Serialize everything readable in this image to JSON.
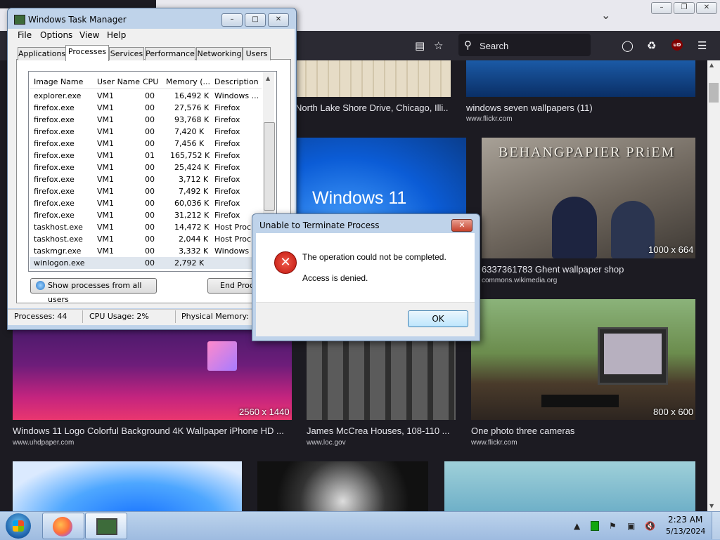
{
  "firefox": {
    "search": {
      "placeholder": "Search"
    },
    "ublock_badge": "uD",
    "cards": [
      {
        "title": "North Lake Shore Drive, Chicago, Illi...",
        "source": "",
        "dims": ""
      },
      {
        "title": "windows seven wallpapers (11)",
        "source": "www.flickr.com",
        "dims": ""
      },
      {
        "title": "",
        "source": "",
        "dims": ""
      },
      {
        "title": "6337361783 Ghent wallpaper shop",
        "source": "commons.wikimedia.org",
        "dims": "1000 x 664"
      },
      {
        "title": "Windows 11 Logo Colorful Background 4K Wallpaper iPhone HD ...",
        "source": "www.uhdpaper.com",
        "dims": "2560 x 1440"
      },
      {
        "title": "James McCrea Houses, 108-110 ...",
        "source": "www.loc.gov",
        "dims": ""
      },
      {
        "title": "One photo three cameras",
        "source": "www.flickr.com",
        "dims": "800 x 600"
      }
    ],
    "windows11_text": "Windows 11",
    "priem_text": "BEHANGPAPIER PRiEM"
  },
  "taskmanager": {
    "title": "Windows Task Manager",
    "menu": [
      "File",
      "Options",
      "View",
      "Help"
    ],
    "tabs": [
      "Applications",
      "Processes",
      "Services",
      "Performance",
      "Networking",
      "Users"
    ],
    "columns": [
      "Image Name",
      "User Name",
      "CPU",
      "Memory (...",
      "Description"
    ],
    "rows": [
      {
        "name": "explorer.exe",
        "user": "VM1",
        "cpu": "00",
        "mem": "16,492 K",
        "desc": "Windows ..."
      },
      {
        "name": "firefox.exe",
        "user": "VM1",
        "cpu": "00",
        "mem": "27,576 K",
        "desc": "Firefox"
      },
      {
        "name": "firefox.exe",
        "user": "VM1",
        "cpu": "00",
        "mem": "93,768 K",
        "desc": "Firefox"
      },
      {
        "name": "firefox.exe",
        "user": "VM1",
        "cpu": "00",
        "mem": "7,420 K",
        "desc": "Firefox"
      },
      {
        "name": "firefox.exe",
        "user": "VM1",
        "cpu": "00",
        "mem": "7,456 K",
        "desc": "Firefox"
      },
      {
        "name": "firefox.exe",
        "user": "VM1",
        "cpu": "01",
        "mem": "165,752 K",
        "desc": "Firefox"
      },
      {
        "name": "firefox.exe",
        "user": "VM1",
        "cpu": "00",
        "mem": "25,424 K",
        "desc": "Firefox"
      },
      {
        "name": "firefox.exe",
        "user": "VM1",
        "cpu": "00",
        "mem": "3,712 K",
        "desc": "Firefox"
      },
      {
        "name": "firefox.exe",
        "user": "VM1",
        "cpu": "00",
        "mem": "7,492 K",
        "desc": "Firefox"
      },
      {
        "name": "firefox.exe",
        "user": "VM1",
        "cpu": "00",
        "mem": "60,036 K",
        "desc": "Firefox"
      },
      {
        "name": "firefox.exe",
        "user": "VM1",
        "cpu": "00",
        "mem": "31,212 K",
        "desc": "Firefox"
      },
      {
        "name": "taskhost.exe",
        "user": "VM1",
        "cpu": "00",
        "mem": "14,472 K",
        "desc": "Host Proc..."
      },
      {
        "name": "taskhost.exe",
        "user": "VM1",
        "cpu": "00",
        "mem": "2,044 K",
        "desc": "Host Proc..."
      },
      {
        "name": "taskmgr.exe",
        "user": "VM1",
        "cpu": "00",
        "mem": "3,332 K",
        "desc": "Windows ..."
      },
      {
        "name": "winlogon.exe",
        "user": "",
        "cpu": "00",
        "mem": "2,792 K",
        "desc": ""
      }
    ],
    "show_all_label": "Show processes from all users",
    "end_process_label": "End Proc...",
    "status": {
      "processes": "Processes: 44",
      "cpu": "CPU Usage: 2%",
      "memory": "Physical Memory: 3"
    }
  },
  "dialog": {
    "title": "Unable to Terminate Process",
    "message": "The operation could not be completed.",
    "detail": "Access is denied.",
    "ok_label": "OK"
  },
  "taskbar": {
    "time": "2:23 AM",
    "date": "5/13/2024"
  }
}
